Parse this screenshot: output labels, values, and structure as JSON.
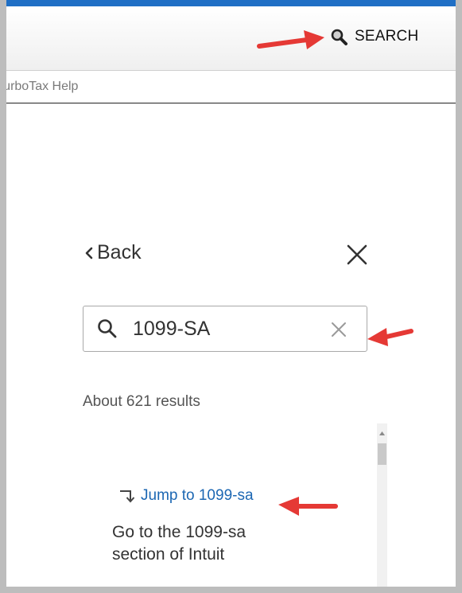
{
  "header": {
    "search_label": "SEARCH"
  },
  "help_bar": {
    "label": "TurboTax Help"
  },
  "panel": {
    "back_label": "Back",
    "search_value": "1099-SA",
    "results_count": "About 621 results",
    "result": {
      "jump_label": "Jump to 1099-sa",
      "description": "Go to the 1099-sa section of Intuit"
    }
  },
  "colors": {
    "accent_blue": "#1f6fc5",
    "link_blue": "#1c67b3",
    "annotation_red": "#e53935"
  }
}
